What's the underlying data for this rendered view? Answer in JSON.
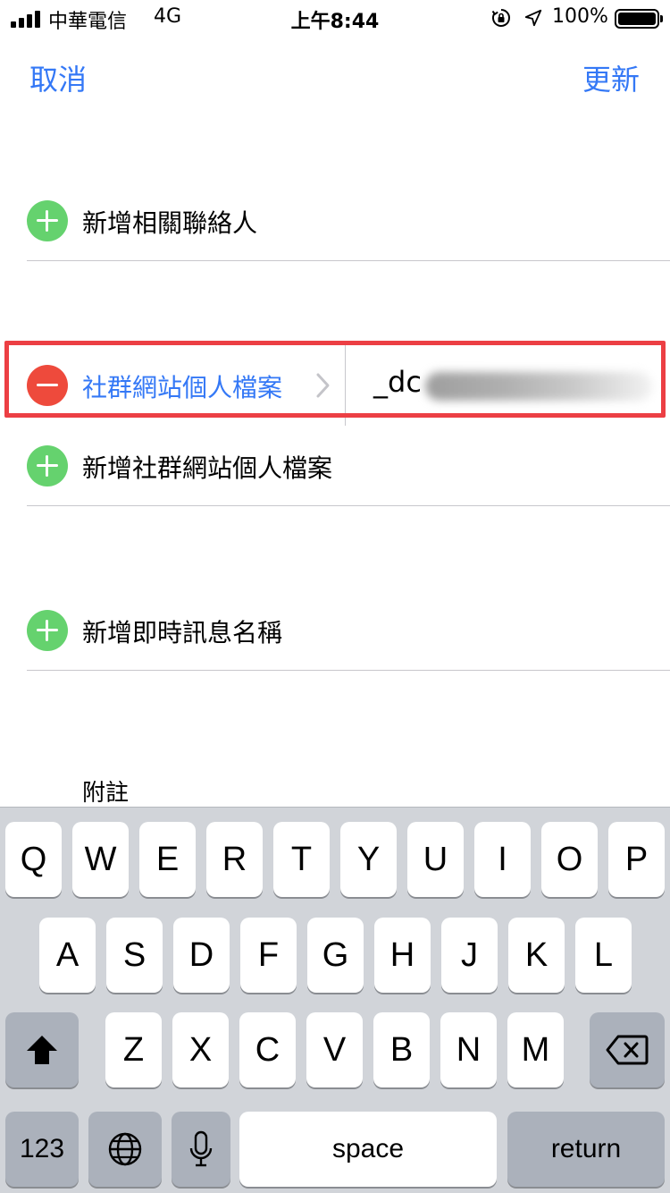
{
  "status_bar": {
    "carrier": "中華電信",
    "network": "4G",
    "time": "上午8:44",
    "battery_percent": "100%",
    "battery_level": 1.0,
    "icons": [
      "signal-bars-icon",
      "orientation-lock-icon",
      "location-arrow-icon",
      "battery-icon"
    ]
  },
  "nav": {
    "cancel_label": "取消",
    "update_label": "更新",
    "accent_color": "#3478f6"
  },
  "rows": {
    "add_related": "新增相關聯絡人",
    "social_profile_label": "社群網站個人檔案",
    "social_profile_value": "_dc",
    "add_social_profile": "新增社群網站個人檔案",
    "add_im": "新增即時訊息名稱",
    "notes": "附註"
  },
  "colors": {
    "add_green": "#65d26e",
    "remove_red": "#ee4a3c",
    "highlight_red": "#ec3f44"
  },
  "keyboard": {
    "row1": [
      "Q",
      "W",
      "E",
      "R",
      "T",
      "Y",
      "U",
      "I",
      "O",
      "P"
    ],
    "row2": [
      "A",
      "S",
      "D",
      "F",
      "G",
      "H",
      "J",
      "K",
      "L"
    ],
    "row3": [
      "Z",
      "X",
      "C",
      "V",
      "B",
      "N",
      "M"
    ],
    "numbers_label": "123",
    "space_label": "space",
    "return_label": "return",
    "icons": [
      "shift-icon",
      "delete-icon",
      "globe-icon",
      "microphone-icon"
    ]
  }
}
